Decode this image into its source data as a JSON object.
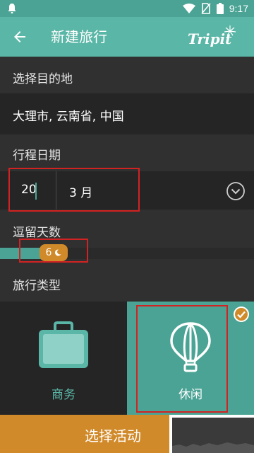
{
  "status_bar": {
    "time": "9:17",
    "icons": [
      "notification-bell-icon",
      "wifi-icon",
      "no-sim-icon",
      "battery-icon"
    ]
  },
  "header": {
    "title": "新建旅行",
    "logo_text": "Tripit",
    "back_icon": "arrow-left-icon"
  },
  "destination": {
    "label": "选择目的地",
    "value": "大理市, 云南省, 中国"
  },
  "trip_date": {
    "label": "行程日期",
    "day": "20",
    "month": "3 月",
    "expand_icon": "chevron-down-circle-icon"
  },
  "stay": {
    "label": "逗留天数",
    "nights": "6",
    "icon": "moon-icon"
  },
  "trip_type": {
    "label": "旅行类型",
    "options": [
      {
        "label": "商务",
        "icon": "briefcase-icon",
        "selected": false
      },
      {
        "label": "休闲",
        "icon": "hot-air-balloon-icon",
        "selected": true
      }
    ]
  },
  "action": {
    "label": "选择活动"
  },
  "colors": {
    "accent": "#4aa394",
    "header": "#5ab6a6",
    "orange": "#d18a2a",
    "background": "#303030",
    "row": "#252525",
    "highlight": "#d22222"
  }
}
